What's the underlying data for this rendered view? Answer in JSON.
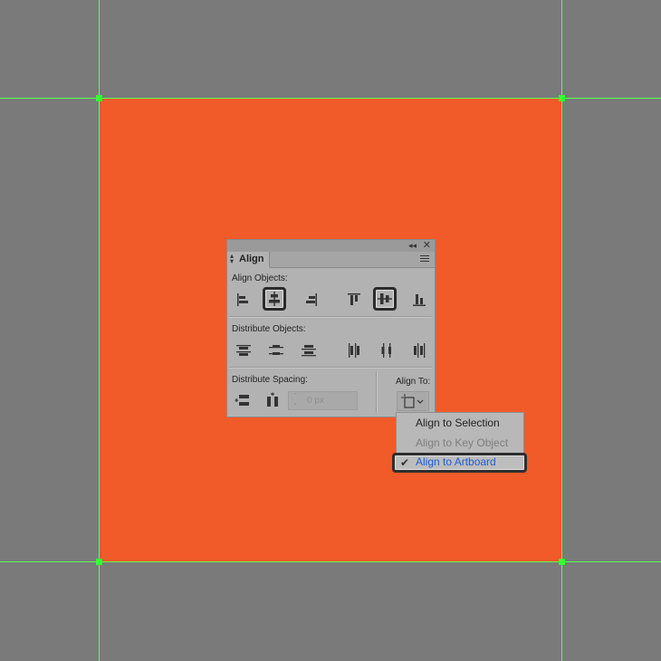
{
  "colors": {
    "canvas": "#7a7a7a",
    "artboard": "#f15a29",
    "guide": "#54ff54",
    "selection_text": "#1d5fd6"
  },
  "panel": {
    "tab_label": "Align",
    "align_objects_label": "Align Objects:",
    "distribute_objects_label": "Distribute Objects:",
    "distribute_spacing_label": "Distribute Spacing:",
    "align_to_label": "Align To:",
    "spacing_value": "0 px",
    "icons": {
      "collapse": "double-chevron-left-icon",
      "close": "close-icon",
      "menu": "hamburger-menu-icon",
      "align_to": "artboard-icon"
    },
    "selected_buttons": [
      "horizontal-align-center",
      "vertical-align-center"
    ]
  },
  "dropdown": {
    "items": [
      {
        "label": "Align to Selection",
        "enabled": true,
        "checked": false
      },
      {
        "label": "Align to Key Object",
        "enabled": false,
        "checked": false
      },
      {
        "label": "Align to Artboard",
        "enabled": true,
        "checked": true
      }
    ]
  }
}
